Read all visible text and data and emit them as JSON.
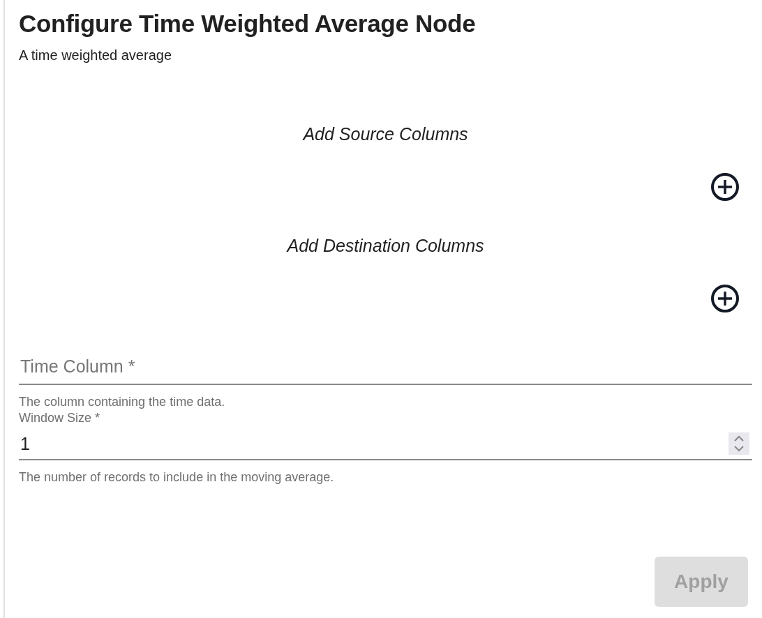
{
  "title": "Configure Time Weighted Average Node",
  "description": "A time weighted average",
  "sections": [
    {
      "label": "Add Source Columns"
    },
    {
      "label": "Add Destination Columns"
    }
  ],
  "time_column": {
    "placeholder": "Time Column *",
    "helper": "The column containing the time data."
  },
  "window_size": {
    "label": "Window Size *",
    "value": "1",
    "helper": "The number of records to include in the moving average."
  },
  "apply_button": {
    "label": "Apply",
    "disabled": true
  }
}
